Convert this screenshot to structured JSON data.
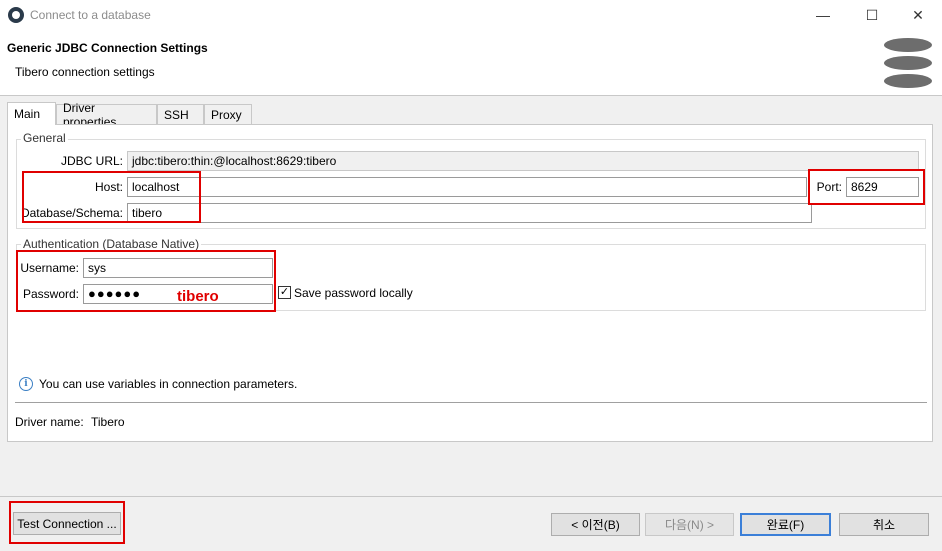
{
  "window": {
    "title": "Connect to a database",
    "minimize_glyph": "—",
    "maximize_glyph": "☐",
    "close_glyph": "✕"
  },
  "header": {
    "title": "Generic JDBC Connection Settings",
    "subtitle": "Tibero connection settings",
    "icon": "database-icon"
  },
  "tabs": [
    {
      "label": "Main",
      "active": true
    },
    {
      "label": "Driver properties",
      "active": false
    },
    {
      "label": "SSH",
      "active": false
    },
    {
      "label": "Proxy",
      "active": false
    }
  ],
  "general": {
    "group_label": "General",
    "jdbc_url_label": "JDBC URL:",
    "jdbc_url_value": "jdbc:tibero:thin:@localhost:8629:tibero",
    "host_label": "Host:",
    "host_value": "localhost",
    "port_label": "Port:",
    "port_value": "8629",
    "database_label": "Database/Schema:",
    "database_value": "tibero"
  },
  "authentication": {
    "group_label": "Authentication (Database Native)",
    "username_label": "Username:",
    "username_value": "sys",
    "password_label": "Password:",
    "password_value": "●●●●●●",
    "password_annotation": "tibero",
    "save_password_label": "Save password locally",
    "save_password_checked": true,
    "check_glyph": "✓"
  },
  "info": {
    "icon": "info-icon",
    "icon_glyph": "i",
    "text": "You can use variables in connection parameters."
  },
  "driver": {
    "label": "Driver name:",
    "value": "Tibero"
  },
  "footer": {
    "test_connection": "Test Connection ...",
    "back": "< 이전(B)",
    "next": "다음(N) >",
    "finish": "완료(F)",
    "cancel": "취소"
  },
  "colors": {
    "highlight": "#e00000",
    "annotation": "#e00000",
    "primary_border": "#3b7fd8",
    "info_blue": "#3b7fc4"
  }
}
